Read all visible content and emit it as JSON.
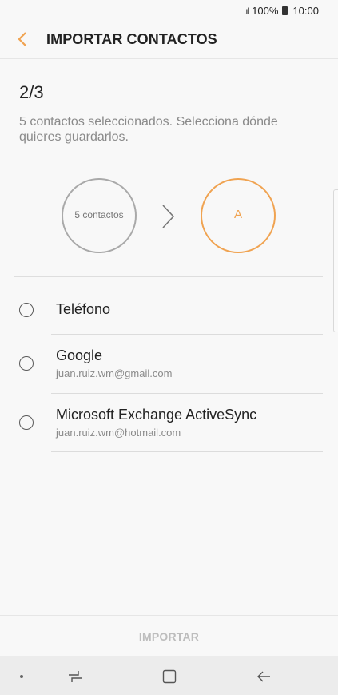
{
  "status_bar": {
    "signal": ".ıl",
    "battery": "100%",
    "time": "10:00"
  },
  "header": {
    "title": "IMPORTAR CONTACTOS"
  },
  "step": "2/3",
  "description": "5 contactos seleccionados. Selecciona dónde quieres guardarlos.",
  "flow": {
    "source_label": "5 contactos",
    "target_label": "A"
  },
  "options": [
    {
      "title": "Teléfono",
      "subtitle": ""
    },
    {
      "title": "Google",
      "subtitle": "juan.ruiz.wm@gmail.com"
    },
    {
      "title": "Microsoft Exchange ActiveSync",
      "subtitle": "juan.ruiz.wm@hotmail.com"
    }
  ],
  "footer": {
    "import_label": "IMPORTAR"
  },
  "colors": {
    "accent": "#f0a351",
    "disabled": "#bdbdbd"
  },
  "icons": [
    "back-chevron-icon",
    "chevron-right-icon",
    "recent-apps-icon",
    "home-icon",
    "back-arrow-icon"
  ]
}
